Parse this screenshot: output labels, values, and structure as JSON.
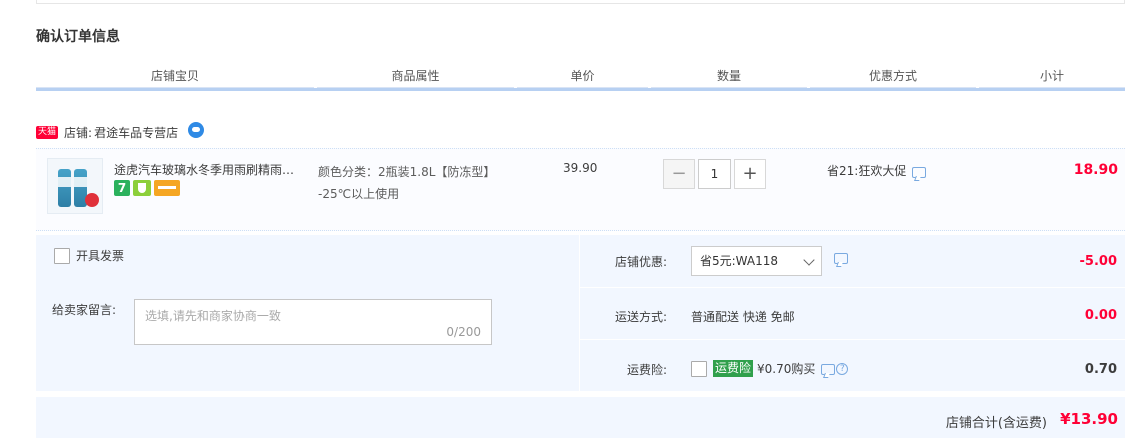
{
  "section_title": "确认订单信息",
  "columns": [
    "店铺宝贝",
    "商品属性",
    "单价",
    "数量",
    "优惠方式",
    "小计"
  ],
  "shop": {
    "badge": "天猫",
    "label": "店铺:",
    "name": "君途车品专营店"
  },
  "item": {
    "title": "途虎汽车玻璃水冬季用雨刷精雨…",
    "attr_line1": "颜色分类：2瓶装1.8L【防冻型】",
    "attr_line2": "-25℃以上使用",
    "price": "39.90",
    "icon_7": "7",
    "quantity": "1",
    "minus": "−",
    "plus": "+",
    "promo": "省21:狂欢大促",
    "subtotal": "18.90"
  },
  "invoice_label": "开具发票",
  "memo": {
    "label": "给卖家留言:",
    "placeholder": "选填,请先和商家协商一致",
    "counter": "0/200"
  },
  "shop_coupon": {
    "label": "店铺优惠:",
    "selected": "省5元:WA118",
    "amount": "-5.00"
  },
  "shipping": {
    "label": "运送方式:",
    "value": "普通配送 快递 免邮",
    "amount": "0.00"
  },
  "insurance": {
    "label": "运费险:",
    "tag": "运费险",
    "text": "¥0.70购买",
    "help": "?",
    "amount": "0.70"
  },
  "total": {
    "label": "店铺合计(含运费)",
    "value": "¥13.90"
  },
  "colors": {
    "price_red": "#ff0036",
    "header_line": "#b7d0f2",
    "panel_bg": "#f2f7ff",
    "insurance_green": "#30a04c"
  }
}
